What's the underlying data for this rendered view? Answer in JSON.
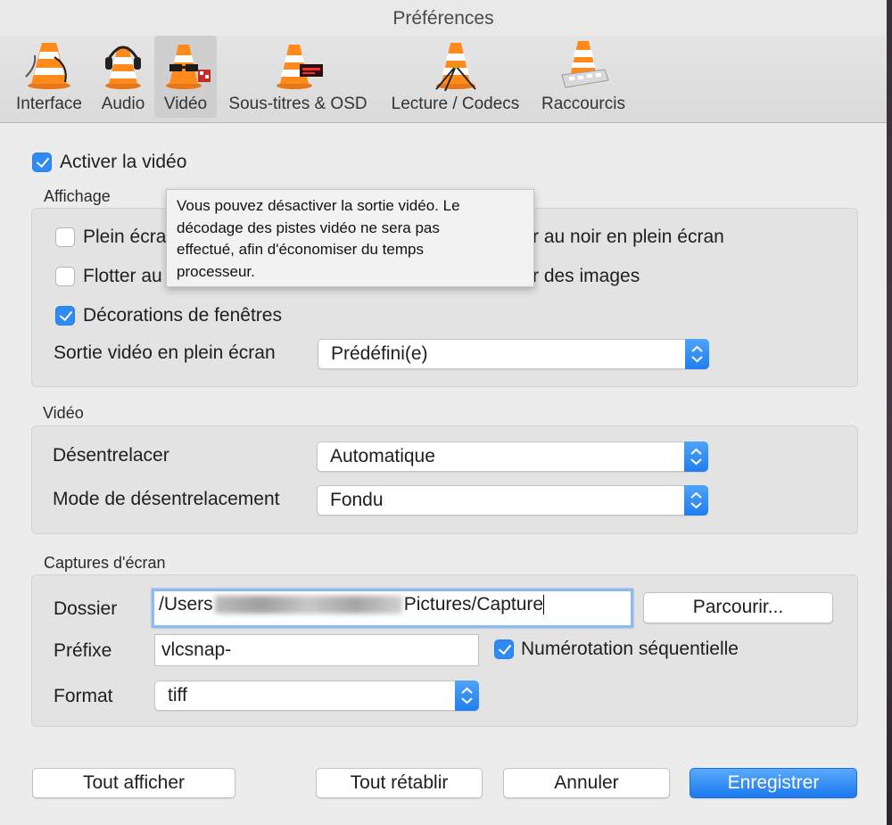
{
  "window": {
    "title": "Préférences"
  },
  "tabs": [
    {
      "label": "Interface",
      "icon": "vlc-cone-interface-icon"
    },
    {
      "label": "Audio",
      "icon": "vlc-cone-headphones-icon"
    },
    {
      "label": "Vidéo",
      "icon": "vlc-cone-glasses-icon",
      "selected": true
    },
    {
      "label": "Sous-titres & OSD",
      "icon": "vlc-cone-subtitles-icon"
    },
    {
      "label": "Lecture / Codecs",
      "icon": "vlc-cone-codecs-icon"
    },
    {
      "label": "Raccourcis",
      "icon": "vlc-cone-keyboard-icon"
    }
  ],
  "enable_video": {
    "label": "Activer la vidéo",
    "checked": true
  },
  "affichage": {
    "title": "Affichage",
    "fullscreen_label": "Plein écra",
    "black_screens_label": "r au noir en plein écran",
    "float_label": "Flotter au",
    "images_label": "r des images",
    "decorations_label": "Décorations de fenêtres",
    "fullscreen_output_label": "Sortie vidéo en plein écran",
    "fullscreen_output_value": "Prédéfini(e)"
  },
  "tooltip": {
    "line1": "Vous pouvez désactiver la sortie vidéo. Le",
    "line2": "décodage des pistes vidéo ne sera pas",
    "line3": "effectué, afin d'économiser du temps",
    "line4": "processeur."
  },
  "video": {
    "title": "Vidéo",
    "deinterlace_label": "Désentrelacer",
    "deinterlace_value": "Automatique",
    "mode_label": "Mode de désentrelacement",
    "mode_value": "Fondu"
  },
  "captures": {
    "title": "Captures d'écran",
    "folder_label": "Dossier",
    "folder_value_start": "/Users",
    "folder_value_end": "Pictures/Capture",
    "browse_label": "Parcourir...",
    "prefix_label": "Préfixe",
    "prefix_value": "vlcsnap-",
    "sequential_label": "Numérotation séquentielle",
    "format_label": "Format",
    "format_value": "tiff"
  },
  "buttons": {
    "show_all": "Tout afficher",
    "reset_all": "Tout rétablir",
    "cancel": "Annuler",
    "save": "Enregistrer"
  },
  "colors": {
    "accent": "#2f8bf4",
    "window_bg": "#ececec",
    "group_bg": "#e3e3e3"
  }
}
